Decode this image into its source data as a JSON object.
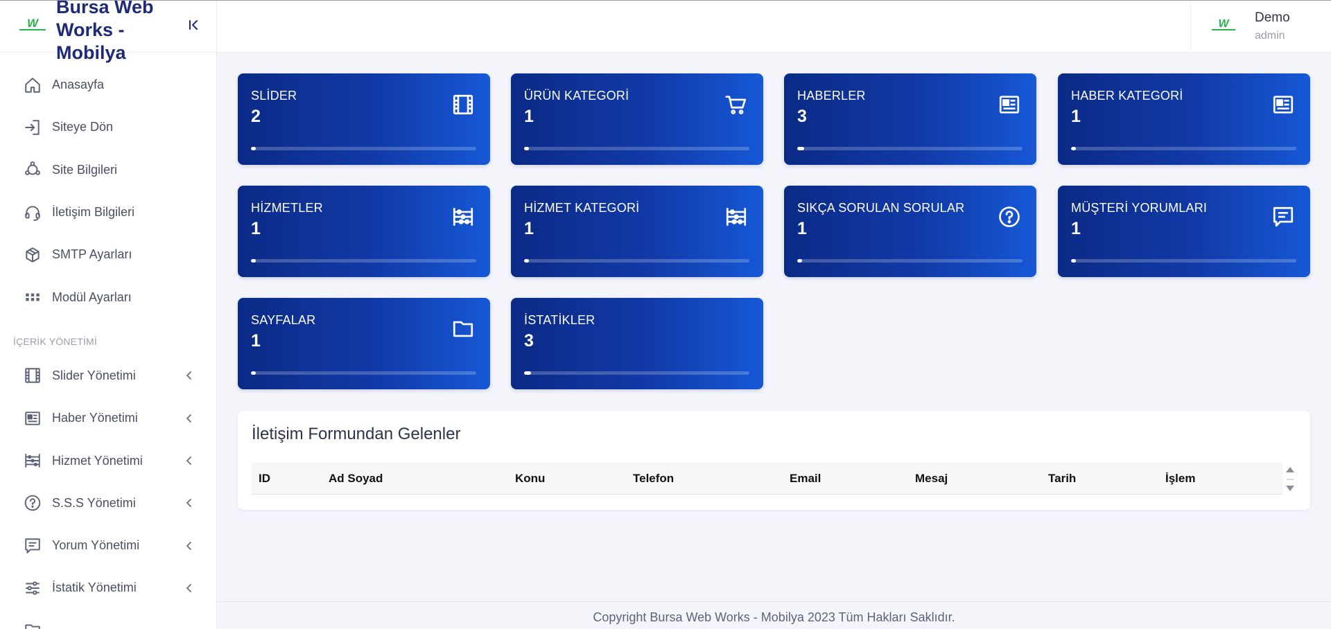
{
  "brand": {
    "name": "Bursa Web Works - Mobilya",
    "logo_text": "W"
  },
  "user": {
    "name": "Demo",
    "role": "admin"
  },
  "sidebar": {
    "items": [
      {
        "label": "Anasayfa",
        "icon": "home-icon"
      },
      {
        "label": "Siteye Dön",
        "icon": "login-icon"
      },
      {
        "label": "Site Bilgileri",
        "icon": "hub-icon"
      },
      {
        "label": "İletişim Bilgileri",
        "icon": "headset-icon"
      },
      {
        "label": "SMTP Ayarları",
        "icon": "box-icon"
      },
      {
        "label": "Modül Ayarları",
        "icon": "grid-icon"
      }
    ],
    "section_title": "İÇERİK YÖNETİMİ",
    "section_items": [
      {
        "label": "Slider Yönetimi",
        "icon": "film-icon"
      },
      {
        "label": "Haber Yönetimi",
        "icon": "news-icon"
      },
      {
        "label": "Hizmet Yönetimi",
        "icon": "abacus-icon"
      },
      {
        "label": "S.S.S Yönetimi",
        "icon": "question-icon"
      },
      {
        "label": "Yorum Yönetimi",
        "icon": "comment-icon"
      },
      {
        "label": "İstatik Yönetimi",
        "icon": "sliders-icon"
      }
    ]
  },
  "cards": [
    {
      "title": "SLİDER",
      "value": "2",
      "icon": "film-icon",
      "progress": 0.02
    },
    {
      "title": "ÜRÜN KATEGORİ",
      "value": "1",
      "icon": "cart-icon",
      "progress": 0.01
    },
    {
      "title": "HABERLER",
      "value": "3",
      "icon": "news-icon",
      "progress": 0.03
    },
    {
      "title": "HABER KATEGORİ",
      "value": "1",
      "icon": "news-icon",
      "progress": 0.01
    },
    {
      "title": "HİZMETLER",
      "value": "1",
      "icon": "abacus-icon",
      "progress": 0.01
    },
    {
      "title": "HİZMET KATEGORİ",
      "value": "1",
      "icon": "abacus-icon",
      "progress": 0.01
    },
    {
      "title": "SIKÇA SORULAN SORULAR",
      "value": "1",
      "icon": "question-icon",
      "progress": 0.01
    },
    {
      "title": "MÜŞTERİ YORUMLARI",
      "value": "1",
      "icon": "comment-icon",
      "progress": 0.01
    },
    {
      "title": "SAYFALAR",
      "value": "1",
      "icon": "folder-icon",
      "progress": 0.01
    },
    {
      "title": "İSTATİKLER",
      "value": "3",
      "icon": "",
      "progress": 0.03
    }
  ],
  "contact_table": {
    "title": "İletişim Formundan Gelenler",
    "columns": [
      "ID",
      "Ad Soyad",
      "Konu",
      "Telefon",
      "Email",
      "Mesaj",
      "Tarih",
      "İşlem"
    ]
  },
  "footer": {
    "text": "Copyright Bursa Web Works - Mobilya 2023 Tüm Hakları Saklıdır."
  },
  "colors": {
    "card_start": "#0b2a86",
    "card_end": "#1658d6",
    "brand_text": "#1e2a78",
    "logo_green": "#2bb24c"
  }
}
